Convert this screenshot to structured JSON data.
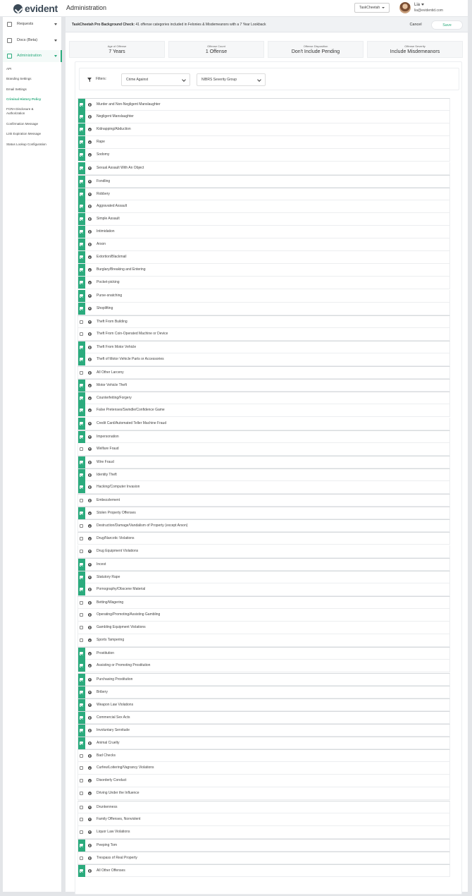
{
  "header": {
    "logo_text": "evident",
    "page_title": "Administration",
    "tenant_select": "TaskCheetah",
    "user_name": "Lia",
    "user_email": "lia@evidentid.com"
  },
  "sidebar": {
    "items": [
      {
        "label": "Requests",
        "icon": "requests-icon"
      },
      {
        "label": "Docs (Beta)",
        "icon": "docs-icon"
      },
      {
        "label": "Administration",
        "icon": "admin-icon"
      }
    ],
    "subitems": [
      {
        "label": "API"
      },
      {
        "label": "Branding Settings"
      },
      {
        "label": "Email Settings"
      },
      {
        "label": "Criminal History Policy"
      },
      {
        "label": "FCRA Disclosure & Authorization"
      },
      {
        "label": "Confirmation Message"
      },
      {
        "label": "Link Expiration Message"
      },
      {
        "label": "Status Lookup Configuration"
      }
    ]
  },
  "infobar": {
    "bold": "TaskCheetah Pro Background Check:",
    "text": " 41 offense categories included in Felonies & Misdemeanors with a 7 Year Lookback",
    "cancel": "Cancel",
    "save": "Save"
  },
  "summary": [
    {
      "label": "Age of Offense",
      "value": "7 Years"
    },
    {
      "label": "Offense Count",
      "value": "1 Offense"
    },
    {
      "label": "Offense Disposition",
      "value": "Don't Include Pending"
    },
    {
      "label": "Offense Severity",
      "value": "Include Misdemeanors"
    }
  ],
  "filters": {
    "label": "Filters:",
    "group_by": "Crime Against",
    "severity": "NIBRS Severity Group"
  },
  "offenses": [
    {
      "label": "Murder and Non-Negligent Manslaughter",
      "checked": true
    },
    {
      "label": "Negligent Manslaughter",
      "checked": true
    },
    {
      "label": "Kidnapping/Abduction",
      "checked": true
    },
    {
      "label": "Rape",
      "checked": true
    },
    {
      "label": "Sodomy",
      "checked": true
    },
    {
      "label": "Sexual Assault With An Object",
      "checked": true
    },
    {
      "label": "Fondling",
      "checked": true
    },
    {
      "label": "Robbery",
      "checked": true
    },
    {
      "label": "Aggravated Assault",
      "checked": true
    },
    {
      "label": "Simple Assault",
      "checked": true
    },
    {
      "label": "Intimidation",
      "checked": true
    },
    {
      "label": "Arson",
      "checked": true
    },
    {
      "label": "Extortion/Blackmail",
      "checked": true
    },
    {
      "label": "Burglary/Breaking and Entering",
      "checked": true
    },
    {
      "label": "Pocket-picking",
      "checked": true
    },
    {
      "label": "Purse-snatching",
      "checked": true
    },
    {
      "label": "Shoplifting",
      "checked": true
    },
    {
      "label": "Theft From Building",
      "checked": false
    },
    {
      "label": "Theft From Coin-Operated Machine or Device",
      "checked": false
    },
    {
      "label": "Theft From Motor Vehicle",
      "checked": true
    },
    {
      "label": "Theft of Motor Vehicle Parts or Accessories",
      "checked": true
    },
    {
      "label": "All Other Larceny",
      "checked": false
    },
    {
      "label": "Motor Vehicle Theft",
      "checked": true
    },
    {
      "label": "Counterfeiting/Forgery",
      "checked": true
    },
    {
      "label": "False Pretenses/Swindle/Confidence Game",
      "checked": true
    },
    {
      "label": "Credit Card/Automated Teller Machine Fraud",
      "checked": true
    },
    {
      "label": "Impersonation",
      "checked": true
    },
    {
      "label": "Welfare Fraud",
      "checked": false
    },
    {
      "label": "Wire Fraud",
      "checked": true
    },
    {
      "label": "Identity Theft",
      "checked": true
    },
    {
      "label": "Hacking/Computer Invasion",
      "checked": true
    },
    {
      "label": "Embezzlement",
      "checked": false
    },
    {
      "label": "Stolen Property Offenses",
      "checked": true
    },
    {
      "label": "Destruction/Damage/Vandalism of Property (except Arson)",
      "checked": false
    },
    {
      "label": "Drug/Narcotic Violations",
      "checked": false
    },
    {
      "label": "Drug Equipment Violations",
      "checked": false
    },
    {
      "label": "Incest",
      "checked": true
    },
    {
      "label": "Statutory Rape",
      "checked": true
    },
    {
      "label": "Pornography/Obscene Material",
      "checked": true
    },
    {
      "label": "Betting/Wagering",
      "checked": false
    },
    {
      "label": "Operating/Promoting/Assisting Gambling",
      "checked": false
    },
    {
      "label": "Gambling Equipment Violations",
      "checked": false
    },
    {
      "label": "Sports Tampering",
      "checked": false
    },
    {
      "label": "Prostitution",
      "checked": true
    },
    {
      "label": "Assisting or Promoting Prostitution",
      "checked": true
    },
    {
      "label": "Purchasing Prostitution",
      "checked": true
    },
    {
      "label": "Bribery",
      "checked": true
    },
    {
      "label": "Weapon Law Violations",
      "checked": true
    },
    {
      "label": "Commercial Sex Acts",
      "checked": true
    },
    {
      "label": "Involuntary Servitude",
      "checked": true
    },
    {
      "label": "Animal Cruelty",
      "checked": true
    },
    {
      "label": "Bad Checks",
      "checked": false
    },
    {
      "label": "Curfew/Loitering/Vagrancy Violations",
      "checked": false
    },
    {
      "label": "Disorderly Conduct",
      "checked": false
    },
    {
      "label": "Driving Under the Influence",
      "checked": false
    },
    {
      "label": "Drunkenness",
      "checked": false
    },
    {
      "label": "Family Offenses, Nonviolent",
      "checked": false
    },
    {
      "label": "Liquor Law Violations",
      "checked": false
    },
    {
      "label": "Peeping Tom",
      "checked": true
    },
    {
      "label": "Trespass of Real Property",
      "checked": false
    },
    {
      "label": "All Other Offenses",
      "checked": true
    }
  ],
  "colors": {
    "accent": "#2bab7d",
    "brand": "#3c4a57"
  }
}
